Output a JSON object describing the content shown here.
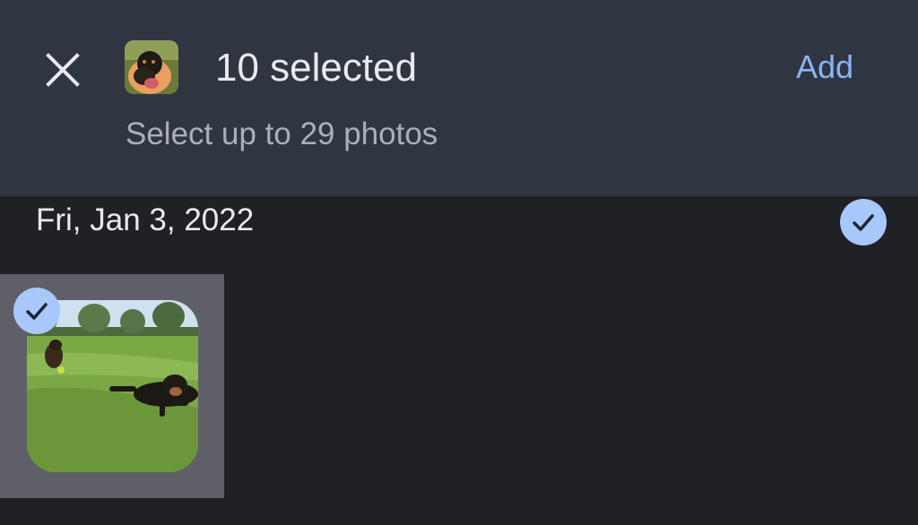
{
  "header": {
    "close_icon": "close-icon",
    "album_thumbnail": "dog-photo-thumbnail",
    "title": "10 selected",
    "subtitle": "Select up to 29 photos",
    "add_label": "Add"
  },
  "section": {
    "date": "Fri, Jan 3, 2022",
    "select_all_checked": true
  },
  "photos": [
    {
      "description": "Two dogs lying on grass in a park",
      "selected": true
    }
  ],
  "colors": {
    "header_bg": "#303641",
    "page_bg": "#202124",
    "accent": "#8ab4f8",
    "check_bg": "#a8c7fa",
    "selected_tile_bg": "#5f6067"
  }
}
